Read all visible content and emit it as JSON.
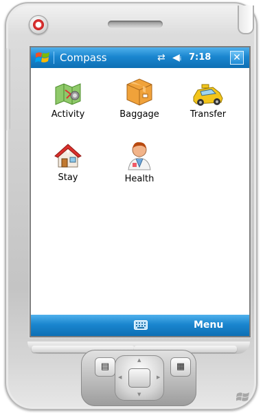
{
  "window": {
    "title": "Compass",
    "clock": "7:18",
    "close_label": "✕",
    "connectivity_icon": "connectivity-icon",
    "volume_icon": "speaker-volume-icon"
  },
  "apps": [
    {
      "label": "Activity",
      "icon": "map-activity-icon"
    },
    {
      "label": "Baggage",
      "icon": "package-box-icon"
    },
    {
      "label": "Transfer",
      "icon": "taxi-car-icon"
    },
    {
      "label": "Stay",
      "icon": "house-icon"
    },
    {
      "label": "Health",
      "icon": "doctor-icon"
    }
  ],
  "menubar": {
    "menu_label": "Menu",
    "keyboard_icon": "keyboard-icon"
  },
  "hardware": {
    "contacts_glyph": "▤",
    "calendar_glyph": "▦"
  },
  "colors": {
    "titlebar": "#1a86cf",
    "accent": "#4fb0ec"
  }
}
